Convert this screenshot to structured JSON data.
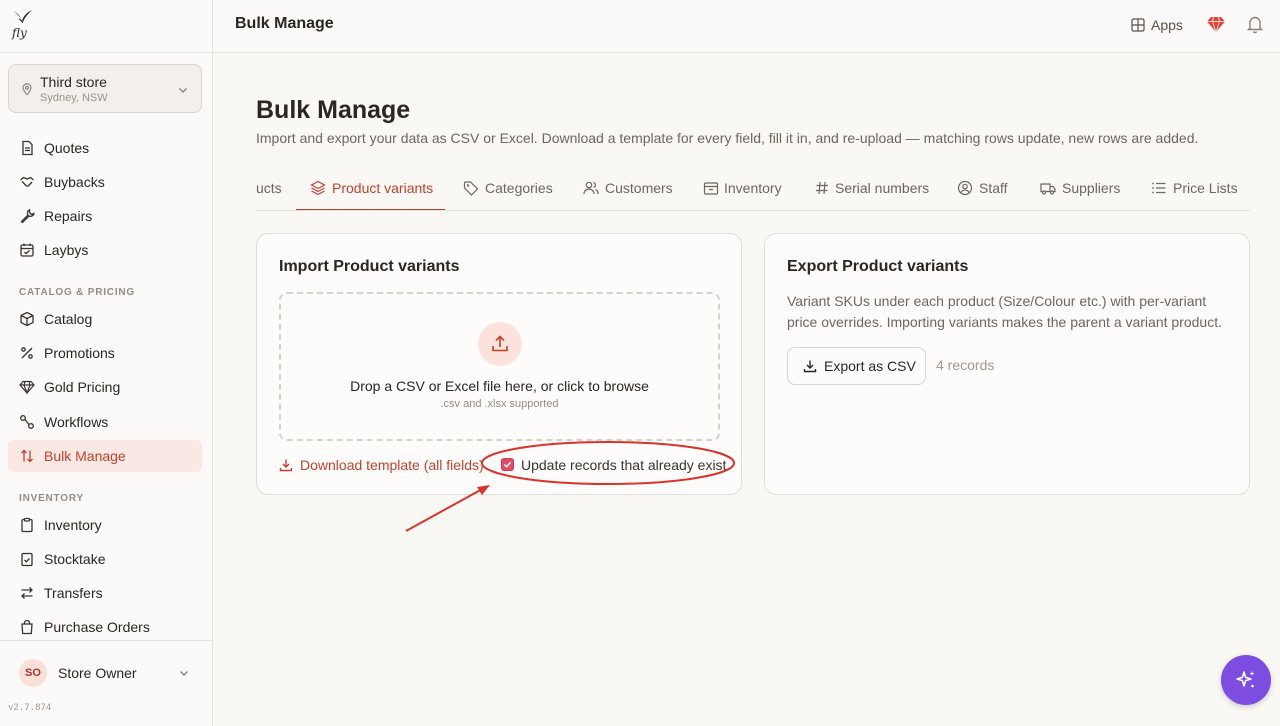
{
  "sidebar": {
    "store": {
      "name": "Third store",
      "location": "Sydney, NSW"
    },
    "items_top": [
      {
        "label": "Quotes",
        "icon": "file-text-icon"
      },
      {
        "label": "Buybacks",
        "icon": "handshake-icon"
      },
      {
        "label": "Repairs",
        "icon": "wrench-icon"
      },
      {
        "label": "Laybys",
        "icon": "calendar-check-icon"
      }
    ],
    "section_catalog": "CATALOG & PRICING",
    "items_catalog": [
      {
        "label": "Catalog",
        "icon": "package-icon"
      },
      {
        "label": "Promotions",
        "icon": "percent-icon"
      },
      {
        "label": "Gold Pricing",
        "icon": "gem-icon"
      },
      {
        "label": "Workflows",
        "icon": "workflow-icon"
      },
      {
        "label": "Bulk Manage",
        "icon": "sort-arrows-icon",
        "active": true
      }
    ],
    "section_inventory": "INVENTORY",
    "items_inventory": [
      {
        "label": "Inventory",
        "icon": "clipboard-icon"
      },
      {
        "label": "Stocktake",
        "icon": "clipboard-check-icon"
      },
      {
        "label": "Transfers",
        "icon": "arrows-swap-icon"
      },
      {
        "label": "Purchase Orders",
        "icon": "shopping-bag-icon"
      }
    ],
    "user": {
      "initials": "SO",
      "name": "Store Owner"
    },
    "version": "v2.7.874"
  },
  "topbar": {
    "title": "Bulk Manage",
    "apps_label": "Apps"
  },
  "main": {
    "title": "Bulk Manage",
    "description": "Import and export your data as CSV or Excel. Download a template for every field, fill it in, and re-upload — matching rows update, new rows are added.",
    "tabs": [
      {
        "label": "ucts",
        "icon": ""
      },
      {
        "label": "Product variants",
        "icon": "layers-icon",
        "active": true
      },
      {
        "label": "Categories",
        "icon": "tag-icon"
      },
      {
        "label": "Customers",
        "icon": "users-icon"
      },
      {
        "label": "Inventory",
        "icon": "archive-icon"
      },
      {
        "label": "Serial numbers",
        "icon": "hash-icon"
      },
      {
        "label": "Staff",
        "icon": "user-circle-icon"
      },
      {
        "label": "Suppliers",
        "icon": "truck-icon"
      },
      {
        "label": "Price Lists",
        "icon": "list-icon"
      }
    ],
    "import": {
      "title": "Import Product variants",
      "drop_text": "Drop a CSV or Excel file here, or click to browse",
      "drop_sub": ".csv and .xlsx supported",
      "download_label": "Download template (all fields)",
      "update_label": "Update records that already exist",
      "update_checked": true
    },
    "export": {
      "title": "Export Product variants",
      "description": "Variant SKUs under each product (Size/Colour etc.) with per-variant price overrides. Importing variants makes the parent a variant product.",
      "button_label": "Export as CSV",
      "records": "4 records"
    }
  },
  "colors": {
    "accent": "#c2412d",
    "active_bg": "#fbe8e4",
    "fab": "#7c4de0",
    "annotation": "#d9342b"
  }
}
